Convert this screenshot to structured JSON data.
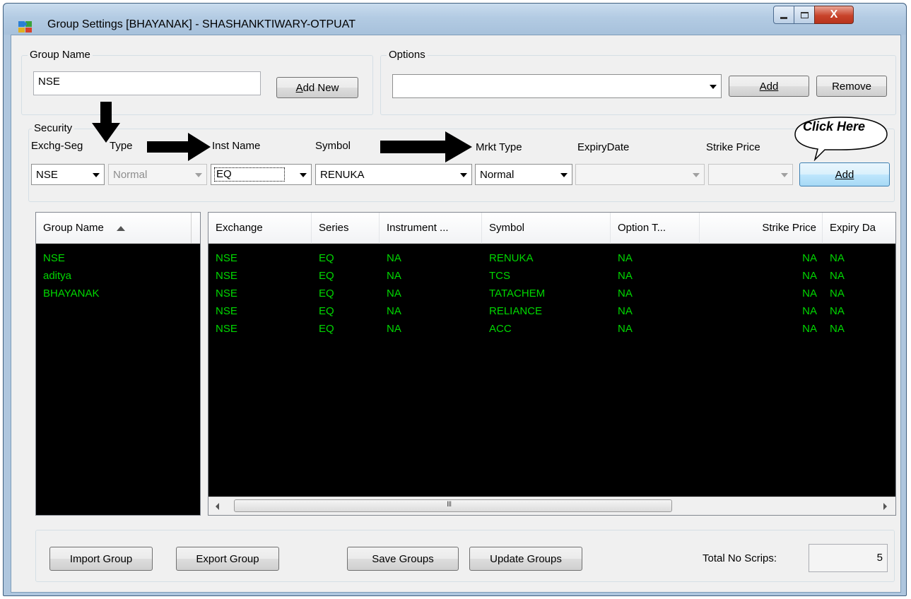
{
  "window": {
    "title": "Group Settings [BHAYANAK] - SHASHANKTIWARY-OTPUAT",
    "close_glyph": "X"
  },
  "group_name": {
    "legend": "Group Name",
    "value": "NSE",
    "add_new_label": "Add New",
    "add_new_mnemonic": "A",
    "add_new_rest": "dd New"
  },
  "options": {
    "legend": "Options",
    "add_label": "Add",
    "remove_label": "Remove"
  },
  "security": {
    "legend": "Security",
    "labels": {
      "exchg_seg": "Exchg-Seg",
      "type": "Type",
      "inst_name": "Inst Name",
      "symbol": "Symbol",
      "mrkt_type": "Mrkt Type",
      "expiry_date": "ExpiryDate",
      "strike_price": "Strike Price"
    },
    "values": {
      "exchg_seg": "NSE",
      "type": "Normal",
      "inst_name": "EQ",
      "symbol": "RENUKA",
      "mrkt_type": "Normal"
    },
    "add_label": "Add",
    "callout": "Click Here"
  },
  "groups_list": {
    "header": "Group Name",
    "items": [
      "NSE",
      "aditya",
      "BHAYANAK"
    ]
  },
  "scrips_table": {
    "columns": [
      "Exchange",
      "Series",
      "Instrument ...",
      "Symbol",
      "Option T...",
      "Strike Price",
      "Expiry Da"
    ],
    "rows": [
      [
        "NSE",
        "EQ",
        "NA",
        "RENUKA",
        "NA",
        "NA",
        "NA"
      ],
      [
        "NSE",
        "EQ",
        "NA",
        "TCS",
        "NA",
        "NA",
        "NA"
      ],
      [
        "NSE",
        "EQ",
        "NA",
        "TATACHEM",
        "NA",
        "NA",
        "NA"
      ],
      [
        "NSE",
        "EQ",
        "NA",
        "RELIANCE",
        "NA",
        "NA",
        "NA"
      ],
      [
        "NSE",
        "EQ",
        "NA",
        "ACC",
        "NA",
        "NA",
        "NA"
      ]
    ],
    "scroll_thumb_glyph": "III"
  },
  "footer": {
    "import_label": "Import Group",
    "export_label": "Export Group",
    "save_label": "Save Groups",
    "update_label": "Update Groups",
    "total_label": "Total No Scrips:",
    "total_value": "5"
  },
  "colors": {
    "grid_text": "#00d800",
    "grid_bg": "#000000",
    "titlebar": "#b3cbe3",
    "close_button": "#c8432b"
  }
}
